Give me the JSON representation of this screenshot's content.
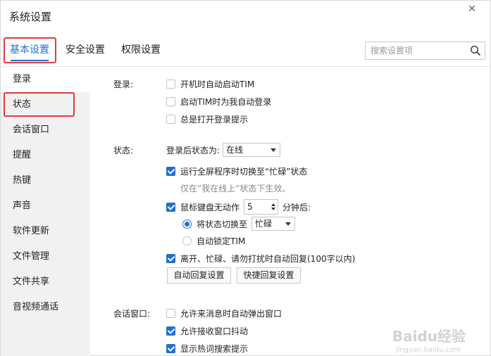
{
  "window": {
    "title": "系统设置",
    "close_glyph": "✕"
  },
  "tabs": [
    {
      "label": "基本设置",
      "active": true
    },
    {
      "label": "安全设置",
      "active": false
    },
    {
      "label": "权限设置",
      "active": false
    }
  ],
  "search": {
    "placeholder": "搜索设置项",
    "value": ""
  },
  "sidebar": {
    "items": [
      {
        "label": "登录"
      },
      {
        "label": "状态",
        "selected": true
      },
      {
        "label": "会话窗口"
      },
      {
        "label": "提醒"
      },
      {
        "label": "热键"
      },
      {
        "label": "声音"
      },
      {
        "label": "软件更新"
      },
      {
        "label": "文件管理"
      },
      {
        "label": "文件共享"
      },
      {
        "label": "音视频通话"
      }
    ]
  },
  "login": {
    "label": "登录:",
    "options": [
      {
        "label": "开机时自动启动TIM",
        "checked": false
      },
      {
        "label": "启动TIM时为我自动登录",
        "checked": false
      },
      {
        "label": "总是打开登录提示",
        "checked": false
      }
    ]
  },
  "status": {
    "label": "状态:",
    "after_login_label": "登录后状态为:",
    "after_login_value": "在线",
    "fullscreen": {
      "label": "运行全屏程序时切换至“忙碌”状态",
      "checked": true
    },
    "fullscreen_hint": "仅在“我在线上”状态下生效。",
    "idle": {
      "label": "鼠标键盘无动作",
      "checked": true,
      "minutes": "5",
      "suffix": "分钟后:"
    },
    "idle_switch": {
      "label": "将状态切换至",
      "selected": true,
      "value": "忙碌"
    },
    "idle_lock": {
      "label": "自动锁定TIM",
      "selected": false
    },
    "auto_reply": {
      "label": "离开、忙碌、请勿打扰时自动回复(100字以内)",
      "checked": true
    },
    "buttons": {
      "auto_reply_settings": "自动回复设置",
      "quick_reply_settings": "快捷回复设置"
    }
  },
  "session": {
    "label": "会话窗口:",
    "options": [
      {
        "label": "允许来消息时自动弹出窗口",
        "checked": false
      },
      {
        "label": "允许接收窗口抖动",
        "checked": true
      },
      {
        "label": "显示热词搜索提示",
        "checked": true
      }
    ]
  },
  "watermark": {
    "logo": "Baidu经验",
    "url": "jingyan.baidu.com"
  },
  "colors": {
    "accent": "#1f6fd6",
    "highlight_box": "#e23a3a",
    "sidebar_bg": "#f1f1f1"
  },
  "icons": {
    "search": "search-icon",
    "close": "close-icon",
    "dropdown": "chevron-down-icon"
  }
}
